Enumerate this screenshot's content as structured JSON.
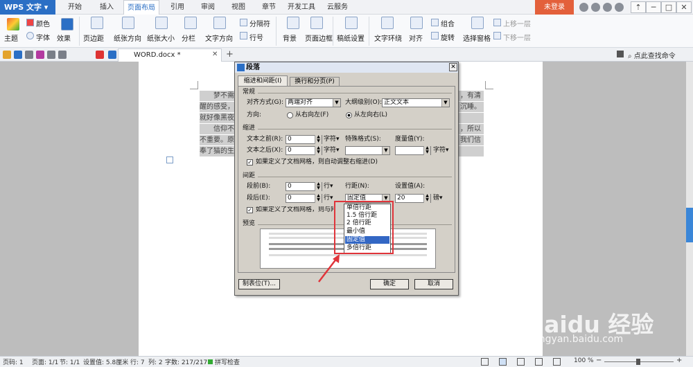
{
  "app": {
    "name": "WPS 文字",
    "login": "未登录"
  },
  "tabs": [
    "开始",
    "插入",
    "页面布局",
    "引用",
    "审阅",
    "视图",
    "章节",
    "开发工具",
    "云服务"
  ],
  "active_tab": "页面布局",
  "ribbon": {
    "theme": "主题",
    "color": "颜色",
    "font": "字体",
    "effect": "效果",
    "margin": "页边距",
    "orientation": "纸张方向",
    "size": "纸张大小",
    "columns": "分栏",
    "text_direction": "文字方向",
    "separator": "分隔符",
    "line_number": "行号",
    "background": "背景",
    "border": "页面边框",
    "manuscript": "稿纸设置",
    "wrap": "文字环绕",
    "align": "对齐",
    "rotate": "旋转",
    "group": "组合",
    "select_pane": "选择窗格",
    "bring_forward": "上移一层",
    "send_backward": "下移一层"
  },
  "doc_tab": "WORD.docx *",
  "search_help": "点此查找命令",
  "doc_lines": [
    "梦不需",
    "醒的感受，",
    "就好像黑夜",
    "信仰不",
    "不重要。原",
    "奉了猫的生"
  ],
  "doc_right": [
    "，有清",
    "沉睡。",
    "，所以",
    "我们信"
  ],
  "dialog": {
    "title": "段落",
    "tabs": [
      "缩进和间距(I)",
      "换行和分页(P)"
    ],
    "general": "常规",
    "alignment_label": "对齐方式(G):",
    "alignment_value": "两端对齐",
    "outline_label": "大纲级别(O):",
    "outline_value": "正文文本",
    "direction_label": "方向:",
    "rtl": "从右向左(F)",
    "ltr": "从左向右(L)",
    "indent": "缩进",
    "before_text_label": "文本之前(R):",
    "before_text_value": "0",
    "before_text_unit": "字符▾",
    "special_label": "特殊格式(S):",
    "measure_label": "度量值(Y):",
    "measure_unit": "字符▾",
    "after_text_label": "文本之后(X):",
    "after_text_value": "0",
    "after_text_unit": "字符▾",
    "grid_indent": "如果定义了文档网格，则自动调整右缩进(D)",
    "spacing": "间距",
    "before_label": "段前(B):",
    "before_value": "0",
    "before_unit": "行▾",
    "line_spacing_label": "行距(N):",
    "line_spacing_value": "固定值",
    "set_value_label": "设置值(A):",
    "set_value": "20",
    "set_unit": "磅▾",
    "after_label": "段后(E):",
    "after_value": "0",
    "after_unit": "行▾",
    "grid_align": "如果定义了文档网格，则与网格对齐",
    "preview": "预览",
    "tabs_button": "制表位(T)...",
    "ok": "确定",
    "cancel": "取消"
  },
  "line_spacing_options": [
    "单倍行距",
    "1.5 倍行距",
    "2 倍行距",
    "最小值",
    "固定值",
    "多倍行距"
  ],
  "selected_option": "固定值",
  "status": {
    "page": "页码: 1",
    "pages": "页面: 1/1",
    "section": "节: 1/1",
    "setting": "设置值: 5.8厘米",
    "row": "行: 7",
    "col": "列: 2",
    "words": "字数: 217/217",
    "spell": "拼写检查",
    "zoom": "100 %"
  },
  "watermark": {
    "brand": "Baidu 经验",
    "url": "jingyan.baidu.com"
  }
}
